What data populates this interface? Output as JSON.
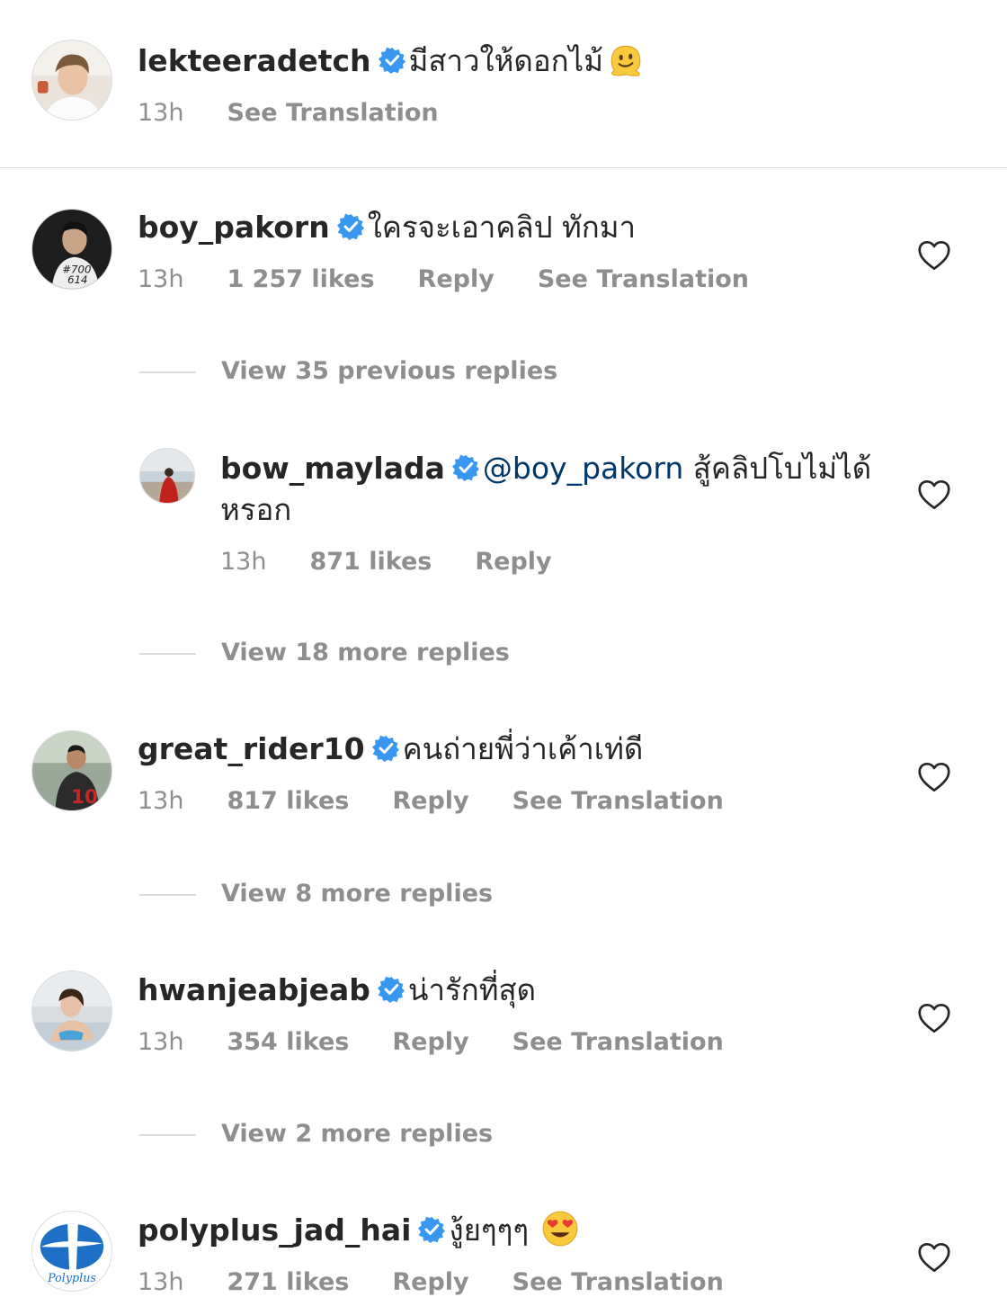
{
  "comments": [
    {
      "username": "lekteeradetch",
      "text": "มีสาวให้ดอกไม้",
      "emoji": "melting-face-emoji",
      "time": "13h",
      "translate": "See Translation"
    },
    {
      "username": "boy_pakorn",
      "text": "ใครจะเอาคลิป ทักมา",
      "time": "13h",
      "likes": "1 257 likes",
      "reply": "Reply",
      "translate": "See Translation",
      "view_replies": "View 35 previous replies"
    },
    {
      "username": "bow_maylada",
      "mention": "@boy_pakorn",
      "text": "สู้คลิปโบไม่ได้",
      "text2": "หรอก",
      "time": "13h",
      "likes": "871 likes",
      "reply": "Reply",
      "view_replies": "View 18 more replies"
    },
    {
      "username": "great_rider10",
      "text": "คนถ่ายพี่ว่าเค้าเท่ดี",
      "time": "13h",
      "likes": "817 likes",
      "reply": "Reply",
      "translate": "See Translation",
      "view_replies": "View 8 more replies"
    },
    {
      "username": "hwanjeabjeab",
      "text": "น่ารักที่สุด",
      "time": "13h",
      "likes": "354 likes",
      "reply": "Reply",
      "translate": "See Translation",
      "view_replies": "View 2 more replies"
    },
    {
      "username": "polyplus_jad_hai",
      "text": "งู้ยๆๆๆ",
      "emoji": "heart-eyes-emoji",
      "time": "13h",
      "likes": "271 likes",
      "reply": "Reply",
      "translate": "See Translation",
      "avatar_logo_text": "Polyplus"
    }
  ],
  "colors": {
    "verified": "#3897f0",
    "text": "#262626",
    "muted": "#8e8e8e",
    "mention": "#00376b"
  }
}
